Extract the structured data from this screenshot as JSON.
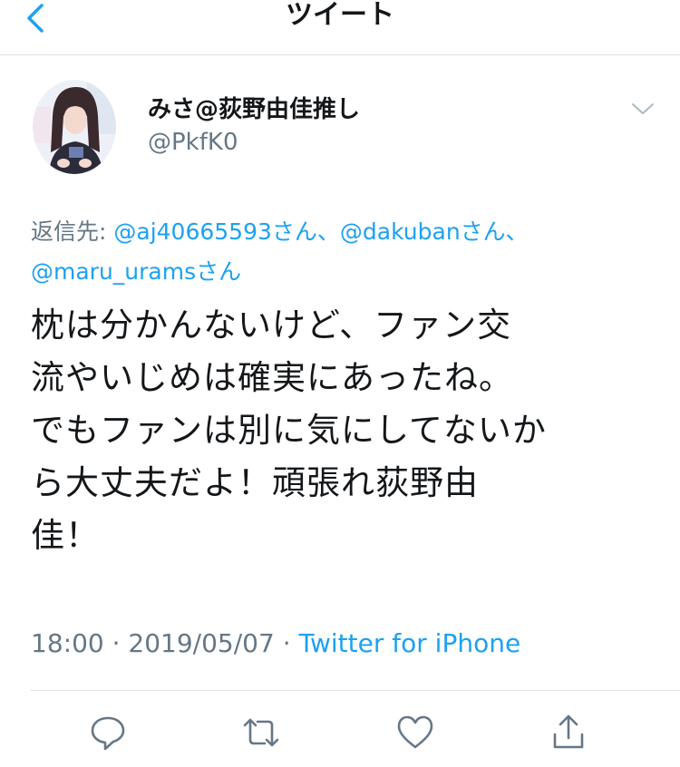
{
  "nav": {
    "title": "ツイート",
    "back_icon": "chevron-left-icon"
  },
  "user": {
    "display_name": "みさ@荻野由佳推し",
    "handle": "@PkfK0"
  },
  "reply": {
    "prefix": "返信先:",
    "mentions": [
      "@aj40665593さん、",
      "@dakubanさん、",
      "@maru_uramsさん"
    ]
  },
  "tweet": {
    "lines": [
      "枕は分かんないけど、ファン交",
      "流やいじめは確実にあったね。",
      "でもファンは別に気にしてないか",
      "ら大丈夫だよ！頑張れ荻野由",
      "佳！"
    ]
  },
  "meta": {
    "time": "18:00",
    "separator": "·",
    "date": "2019/05/07",
    "source": "Twitter for iPhone"
  },
  "actions": [
    "reply-icon",
    "retweet-icon",
    "like-icon",
    "share-icon"
  ],
  "colors": {
    "accent": "#1da1f2",
    "secondary_text": "#657786",
    "primary_text": "#14171a",
    "divider": "#dfe3e6"
  }
}
